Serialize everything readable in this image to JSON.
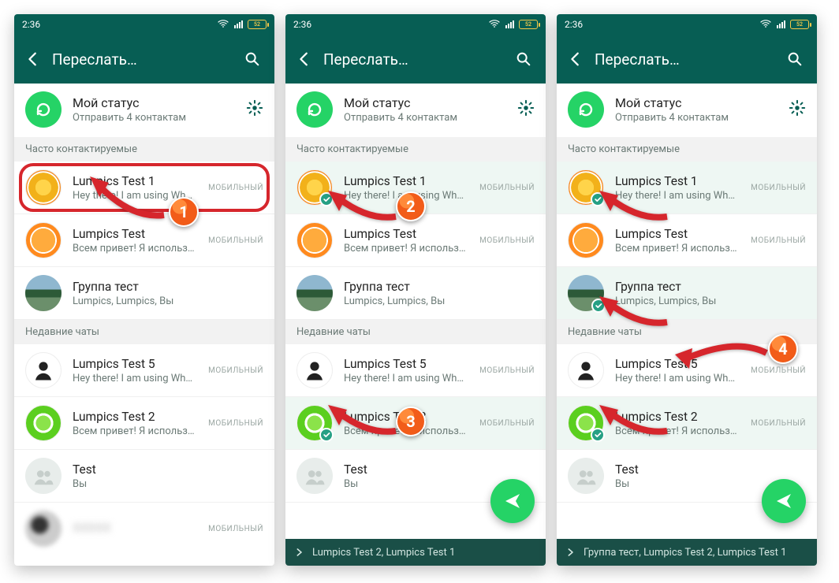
{
  "statusbar": {
    "time": "2:36",
    "battery": "52"
  },
  "appbar": {
    "title": "Переслать…"
  },
  "status": {
    "title": "Мой статус",
    "subtitle": "Отправить 4 контактам"
  },
  "sections": {
    "frequent": "Часто контактируемые",
    "recent": "Недавние чаты"
  },
  "tag_mobile": "МОБИЛЬНЫЙ",
  "contacts": {
    "c1": {
      "name": "Lumpics Test 1",
      "sub": "Hey there! I am using WhatsApp."
    },
    "c2": {
      "name": "Lumpics Test",
      "sub": "Всем привет! Я использую WhatsApp."
    },
    "c3": {
      "name": "Группа тест",
      "sub": "Lumpics, Lumpics, Вы"
    },
    "c4": {
      "name": "Lumpics Test 5",
      "sub": "Hey there! I am using WhatsApp."
    },
    "c5": {
      "name": "Lumpics Test 2",
      "sub": "Всем привет! Я использую WhatsApp."
    },
    "c6": {
      "name": "Test",
      "sub": "Вы"
    },
    "c7": {
      "name": "hidden",
      "sub": "hidden"
    }
  },
  "bottom": {
    "p2": "Lumpics Test 2, Lumpics Test 1",
    "p3": "Группа тест, Lumpics Test 2, Lumpics Test 1"
  },
  "badges": {
    "b1": "1",
    "b2": "2",
    "b3": "3",
    "b4": "4"
  }
}
